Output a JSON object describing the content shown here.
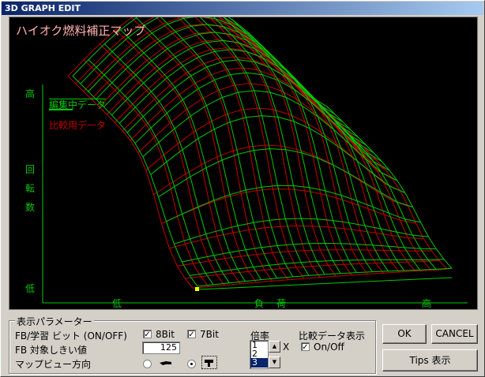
{
  "window": {
    "title": "3D GRAPH EDIT"
  },
  "graph": {
    "map_title": "ハイオク燃料補正マップ",
    "legend": {
      "edit_label": "編集中データ",
      "compare_label": "比較用データ"
    },
    "y_axis": {
      "high": "高",
      "label_1": "回",
      "label_2": "転",
      "label_3": "数",
      "low": "低"
    },
    "x_axis": {
      "low": "低",
      "label_1": "負",
      "label_2": "荷",
      "high": "高"
    },
    "colors": {
      "edit": "#00c800",
      "compare": "#c00000",
      "background": "#000000",
      "marker": "#ffff00"
    }
  },
  "params": {
    "legend": "表示パラメーター",
    "fb_bit_label": "FB/学習 ビット (ON/OFF)",
    "bit8_label": "8Bit",
    "bit8_checked": "✓",
    "bit7_label": "7Bit",
    "bit7_checked": "✓",
    "threshold_label": "FB 対象しきい値",
    "threshold_value": "125",
    "view_direction_label": "マップビュー方向"
  },
  "scale": {
    "label": "倍率",
    "options": [
      "1",
      "2",
      "3"
    ],
    "selected": "3",
    "x_label": "X"
  },
  "compare": {
    "label": "比較データ表示",
    "onoff_label": "On/Off",
    "checked": "✓"
  },
  "buttons": {
    "ok": "OK",
    "cancel": "CANCEL",
    "tips": "Tips 表示"
  }
}
